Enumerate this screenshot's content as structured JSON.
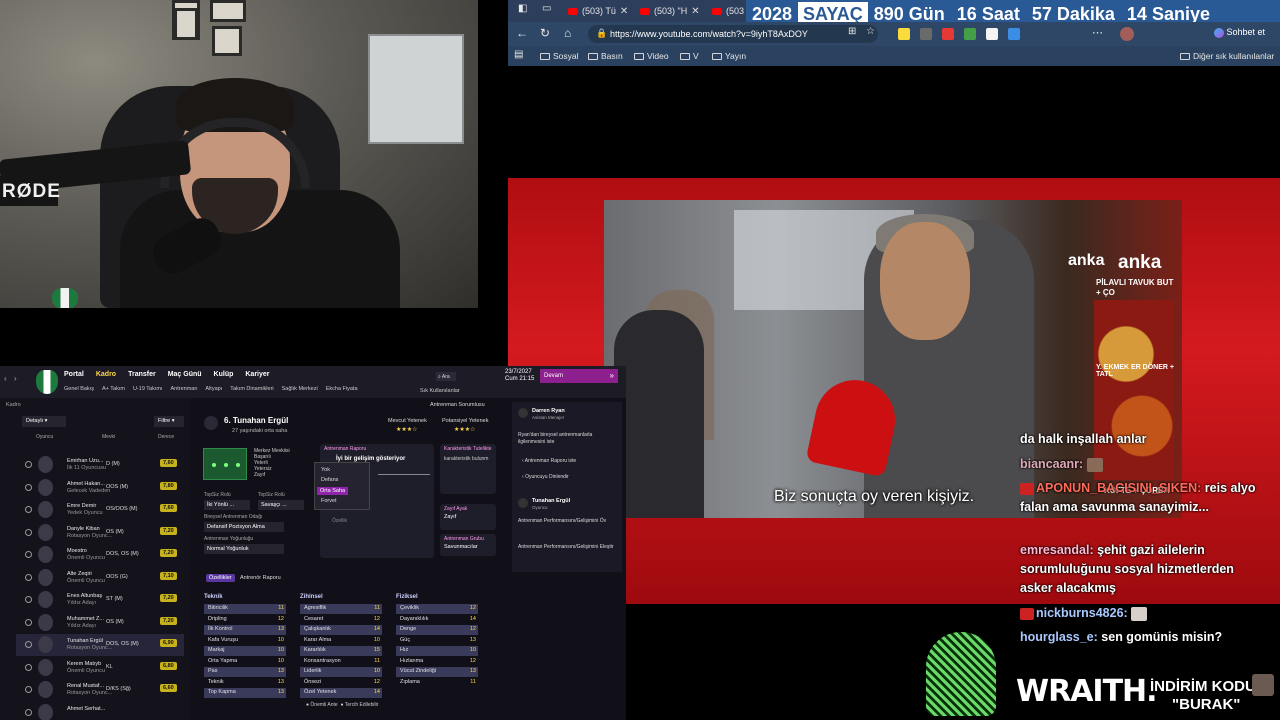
{
  "counter": {
    "year": "2028",
    "label": "SAYAÇ",
    "days": "890 Gün",
    "hours": "16 Saat",
    "minutes": "57 Dakika",
    "seconds": "14 Saniye"
  },
  "tabs": [
    {
      "label": "(503) Tü"
    },
    {
      "label": "(503) \"H"
    },
    {
      "label": "(503"
    }
  ],
  "address": {
    "url": "https://www.youtube.com/watch?v=9iyhT8AxDOY",
    "chat_label": "Sohbet et"
  },
  "bookmarks": [
    {
      "label": "Sosyal"
    },
    {
      "label": "Basın"
    },
    {
      "label": "Video"
    },
    {
      "label": "V"
    },
    {
      "label": "Yayın"
    }
  ],
  "bookmarks_right": "Diğer sık kullanılanlar",
  "webcam": {
    "brand": "RØDE"
  },
  "video": {
    "subtitle": "Biz sonuçta oy veren kişiyiz.",
    "brand_small": "anka",
    "brand_big": "anka",
    "storefront_lines": [
      "PİLAVLI TAVUK BUT + ÇO",
      "Y. EKMEK ER DÖNER + TATL",
      "KÖFTE + ÇORBA"
    ]
  },
  "chat": [
    {
      "user": "",
      "text": "da halk inşallah anlar"
    },
    {
      "user": "biancaanr:",
      "text": ""
    },
    {
      "user": "APONUN_BACISINI_SIKEN:",
      "text": "reis alyo falan ama savunma sanayimiz..."
    },
    {
      "user": "emresandal:",
      "text": "şehit gazi ailelerin sorumluluğunu sosyal hizmetlerden asker alacakmış"
    },
    {
      "user": "nickburns4826:",
      "text": ""
    },
    {
      "user": "hourglass_e:",
      "text": "sen gomünis misin?"
    }
  ],
  "sponsor": {
    "brand": "WRAITH.",
    "line1": "İNDİRİM KODU:",
    "line2": "\"BURAK\""
  },
  "fm": {
    "nav": [
      {
        "label": "Portal"
      },
      {
        "label": "Kadro"
      },
      {
        "label": "Transfer"
      },
      {
        "label": "Maç Günü"
      },
      {
        "label": "Kulüp"
      },
      {
        "label": "Kariyer"
      }
    ],
    "subnav": [
      "Genel Bakış",
      "A+ Takım",
      "U-19 Takımı",
      "Antrenman",
      "Altyapı",
      "Takım Dinamikleri",
      "Sağlık Merkezi",
      "Ekcha Fiyata"
    ],
    "date": "23/7/2027",
    "day": "Cum 21:15",
    "continue": "Devam",
    "breadcrumb": "Kadro",
    "view": "Detaylı",
    "filter": "Filtre",
    "col_player": "Oyuncu",
    "col_pos": "Mevki",
    "col_rating": "Derece",
    "players": [
      {
        "name": "Emirhan Uzu...",
        "role": "İlk 11 Oyuncusu",
        "pos": "D (M)",
        "rating": "7,60"
      },
      {
        "name": "Ahmet Hakan...",
        "role": "Gelecek Vadeden",
        "pos": "OOS (M)",
        "rating": "7,80"
      },
      {
        "name": "Emre Demir",
        "role": "Yedek Oyuncu",
        "pos": "OS/OOS (M)",
        "rating": "7,60"
      },
      {
        "name": "Danyle Kiban",
        "role": "Rotasyon Oyunc...",
        "pos": "OS (M)",
        "rating": "7,20"
      },
      {
        "name": "Moestro",
        "role": "Önemli Oyuncu",
        "pos": "DOS, OS (M)",
        "rating": "7,20"
      },
      {
        "name": "Alte Zeqiri",
        "role": "Önemli Oyuncu",
        "pos": "OOS (G)",
        "rating": "7,10"
      },
      {
        "name": "Enes Altunbaş",
        "role": "Yıldız Adayı",
        "pos": "ST (M)",
        "rating": "7,20"
      },
      {
        "name": "Muhammet Z...",
        "role": "Yıldız Adayı",
        "pos": "OS (M)",
        "rating": "7,20"
      },
      {
        "name": "Tunahan Ergül",
        "role": "Rotasyon Oyunc...",
        "pos": "DOS, OS (M)",
        "rating": "6,90"
      },
      {
        "name": "Kerem Matıyb",
        "role": "Önemli Oyuncu",
        "pos": "KL",
        "rating": "6,80"
      },
      {
        "name": "Renal Mustaf...",
        "role": "Rotasyon Oyunc...",
        "pos": "D/KS (Sğ)",
        "rating": "6,60"
      },
      {
        "name": "Ahmet Serhat...",
        "role": "",
        "pos": "",
        "rating": ""
      }
    ],
    "player": {
      "name": "6. Tunahan Ergül",
      "sub": "27 yaşındaki orta saha",
      "current": "Mevcut Yetenek",
      "potential": "Potansiyel Yetenek",
      "report": "Antrenman Raporu",
      "progress": "İyi bir gelişim gösteriyor",
      "char_title": "Karakteristik Tutelikte",
      "char_text": "karakteristik bulunm",
      "top_role": "TopSiz Rolü",
      "top_role_val": "İki Yönlü ...",
      "role2": "TopSiz Rolü",
      "role2_val": "Savaşçı ...",
      "position_label": "Bireysel Antrenman Odağı",
      "position_val": "Defansif Pozisyon Alma",
      "intensity_label": "Antrenman Yoğunluğu",
      "intensity_val": "Normal Yoğunluk",
      "dropdown": [
        "Yok",
        "Defans",
        "Orta Saha",
        "Forvet"
      ],
      "dd_selected": "Orta Saha",
      "attr_label": "Özellik",
      "weak": "Zayıf Ayak",
      "weak_val": "Zayıf",
      "training_group": "Antrenman Grubu",
      "group_val": "Savunmacılar",
      "feat_tab": "Özellikler",
      "report_tab": "Antrenör Raporu",
      "legend1": "Önemli Ante",
      "legend2": "Tercih Edilebilir",
      "positions": [
        "Merkez Mevkiisi",
        "Başarılı",
        "Yeterli",
        "Yetersiz",
        "Zayıf"
      ]
    },
    "attrs": {
      "teknik_title": "Teknik",
      "zihinsel_title": "Zihinsel",
      "fiziksel_title": "Fiziksel",
      "teknik": [
        [
          "Bitiricilik",
          "11"
        ],
        [
          "Dripling",
          "12"
        ],
        [
          "İlk Kontrol",
          "13"
        ],
        [
          "Kafa Vuruşu",
          "10"
        ],
        [
          "Markaj",
          "10"
        ],
        [
          "Orta Yapma",
          "10"
        ],
        [
          "Pas",
          "13"
        ],
        [
          "Teknik",
          "13"
        ],
        [
          "Top Kapma",
          "13"
        ]
      ],
      "zihinsel": [
        [
          "Agresiflik",
          "11"
        ],
        [
          "Cesaret",
          "12"
        ],
        [
          "Çalışkanlık",
          "14"
        ],
        [
          "Karar Alma",
          "10"
        ],
        [
          "Kararlılık",
          "15"
        ],
        [
          "Konsantrasyon",
          "11"
        ],
        [
          "Liderlik",
          "10"
        ],
        [
          "Önsezi",
          "12"
        ],
        [
          "Özel Yetenek",
          "14"
        ]
      ],
      "fiziksel": [
        [
          "Çeviklik",
          "12"
        ],
        [
          "Dayanıklılık",
          "14"
        ],
        [
          "Denge",
          "12"
        ],
        [
          "Güç",
          "13"
        ],
        [
          "Hız",
          "10"
        ],
        [
          "Hızlanma",
          "12"
        ],
        [
          "Vücut Zindeliği",
          "13"
        ],
        [
          "Zıplama",
          "11"
        ]
      ]
    },
    "side": {
      "name": "Darren Ryan",
      "role": "Asistan Menajer",
      "msg": "Ryan'dan bireysel antrenmanlarla ilgilenmesini iste",
      "link1": "Antrenman Raporu iste",
      "link2": "Oyuncuyu Dinlendir",
      "p_name": "Tunahan Ergül",
      "p_role": "Oyuncu",
      "act1": "Antrenman Performansını/Gelişimini Öv",
      "act2": "Antrenman Performansını/Gelişimini Eleştir"
    },
    "sort_label": "Sık Kullanılanlar",
    "report_btn": "Antrenman Sorumlusu"
  },
  "colors": {
    "counter_bg": "#2a5a96",
    "red_band": "#d41a1f",
    "fm_bg": "#111018",
    "fm_accent": "#8e24aa"
  }
}
